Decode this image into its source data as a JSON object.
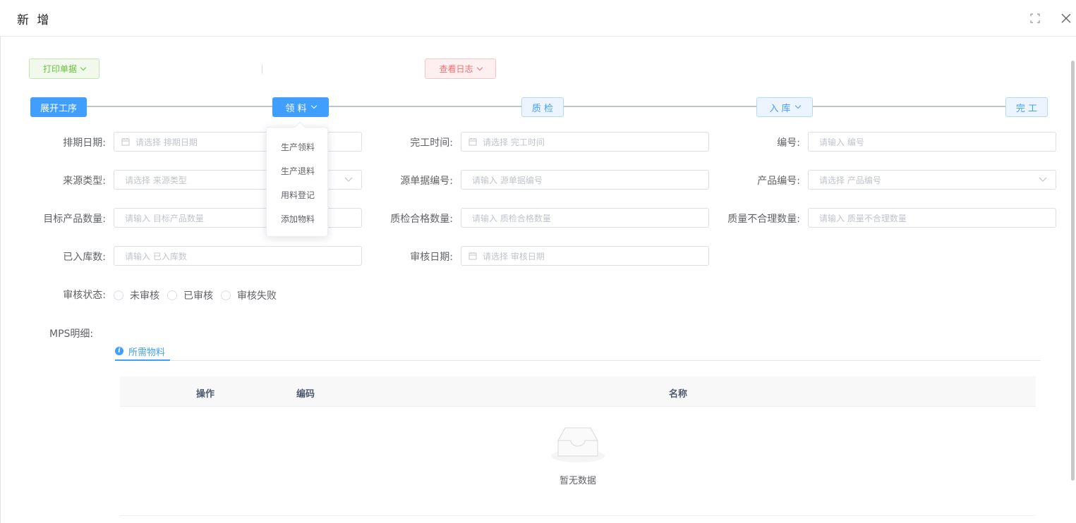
{
  "dialog": {
    "title": "新 增"
  },
  "toolbar": {
    "print_label": "打印单据",
    "log_label": "查看日志"
  },
  "steps": [
    {
      "label": "展开工序",
      "has_dropdown": false
    },
    {
      "label": "领 料",
      "has_dropdown": true
    },
    {
      "label": "质 检",
      "has_dropdown": false
    },
    {
      "label": "入 库",
      "has_dropdown": true
    },
    {
      "label": "完 工",
      "has_dropdown": false
    }
  ],
  "dropdown_menu": {
    "items": [
      "生产领料",
      "生产退料",
      "用料登记",
      "添加物料"
    ]
  },
  "form": {
    "schedule_date": {
      "label": "排期日期:",
      "placeholder": "请选择 排期日期"
    },
    "finish_time": {
      "label": "完工时间:",
      "placeholder": "请选择 完工时间"
    },
    "number": {
      "label": "编号:",
      "placeholder": "请输入 编号"
    },
    "source_type": {
      "label": "来源类型:",
      "placeholder": "请选择 来源类型"
    },
    "source_doc_no": {
      "label": "源单据编号:",
      "placeholder": "请输入 源单据编号"
    },
    "product_no": {
      "label": "产品编号:",
      "placeholder": "请选择 产品编号"
    },
    "target_qty": {
      "label": "目标产品数量:",
      "placeholder": "请输入 目标产品数量"
    },
    "qc_pass_qty": {
      "label": "质检合格数量:",
      "placeholder": "请输入 质检合格数量"
    },
    "quality_fail_qty": {
      "label": "质量不合理数量:",
      "placeholder": "请输入 质量不合理数量"
    },
    "stocked_qty": {
      "label": "已入库数:",
      "placeholder": "请输入 已入库数"
    },
    "audit_date": {
      "label": "审核日期:",
      "placeholder": "请选择 审核日期"
    },
    "audit_status": {
      "label": "审核状态:",
      "options": [
        "未审核",
        "已审核",
        "审核失败"
      ]
    }
  },
  "mps": {
    "label": "MPS明细:",
    "tab_label": "所需物料",
    "columns": [
      "操作",
      "编码",
      "名称"
    ],
    "empty_text": "暂无数据"
  },
  "colors": {
    "primary": "#409eff",
    "success": "#67c23a",
    "danger": "#f56c6c"
  }
}
